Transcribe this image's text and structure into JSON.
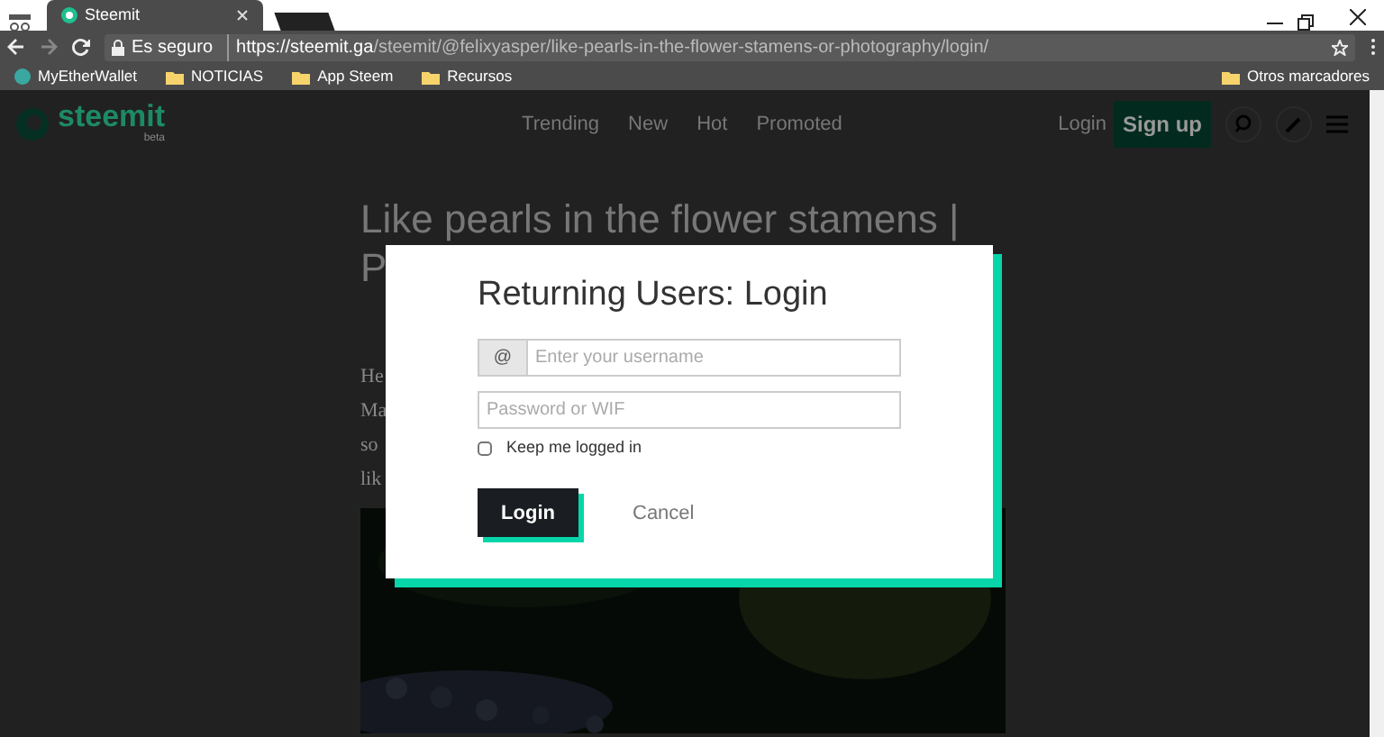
{
  "browser": {
    "tabs": [
      {
        "title": "Steemit",
        "selected": true
      }
    ],
    "security": "Es seguro",
    "url_host": "https://steemit.ga",
    "url_path": "/steemit/@felixyasper/like-pearls-in-the-flower-stamens-or-photography/login/",
    "bookmarks": [
      {
        "label": "MyEtherWallet",
        "kind": "site"
      },
      {
        "label": "NOTICIAS",
        "kind": "folder"
      },
      {
        "label": "App Steem",
        "kind": "folder"
      },
      {
        "label": "Recursos",
        "kind": "folder"
      }
    ],
    "other_bookmarks": "Otros marcadores"
  },
  "site": {
    "logo": "steemit",
    "logo_tag": "beta",
    "nav": [
      "Trending",
      "New",
      "Hot",
      "Promoted"
    ],
    "login": "Login",
    "signup": "Sign up"
  },
  "article": {
    "title_lines": [
      "Like pearls in the flower stamens |",
      "P"
    ],
    "text_fragments": [
      "He",
      "Ma",
      "so",
      "lik"
    ]
  },
  "modal": {
    "title": "Returning Users: Login",
    "username_prefix": "@",
    "username_placeholder": "Enter your username",
    "password_placeholder": "Password or WIF",
    "remember": {
      "label": "Keep me logged in",
      "checked": false
    },
    "submit": "Login",
    "cancel": "Cancel"
  }
}
